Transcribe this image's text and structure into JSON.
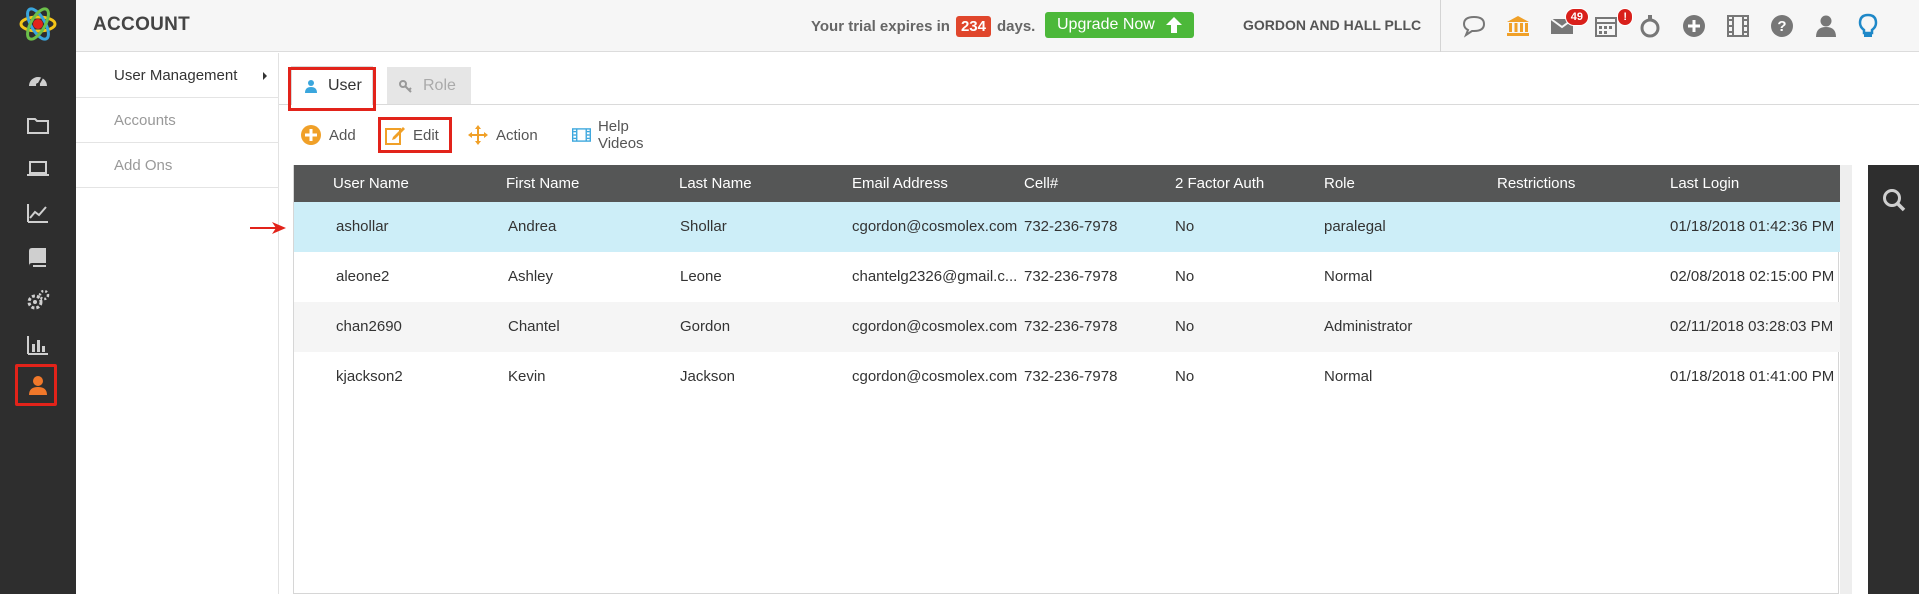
{
  "app": {
    "title": "ACCOUNT"
  },
  "header": {
    "trial_prefix": "Your trial expires in",
    "trial_days": "234",
    "trial_suffix": "days.",
    "upgrade_label": "Upgrade Now",
    "firm_name": "GORDON AND HALL PLLC",
    "icons": [
      {
        "name": "chat-icon"
      },
      {
        "name": "bank-icon"
      },
      {
        "name": "mail-icon",
        "badge": "49"
      },
      {
        "name": "calendar-icon",
        "badge": "!"
      },
      {
        "name": "timer-icon"
      },
      {
        "name": "add-circle-icon"
      },
      {
        "name": "film-icon"
      },
      {
        "name": "help-icon"
      },
      {
        "name": "user-profile-icon"
      },
      {
        "name": "lightbulb-icon"
      }
    ]
  },
  "rail": {
    "items": [
      "dashboard-icon",
      "folder-icon",
      "laptop-icon",
      "chart-line-icon",
      "book-icon",
      "gears-icon",
      "bar-chart-icon",
      "account-user-icon"
    ],
    "active": "account-user-icon"
  },
  "subnav": {
    "items": [
      {
        "label": "User Management",
        "selected": true
      },
      {
        "label": "Accounts",
        "selected": false
      },
      {
        "label": "Add Ons",
        "selected": false
      }
    ]
  },
  "tabs": [
    {
      "label": "User",
      "active": true
    },
    {
      "label": "Role",
      "active": false
    }
  ],
  "toolbar": {
    "add": "Add",
    "edit": "Edit",
    "action": "Action",
    "help_videos": "Help Videos"
  },
  "grid": {
    "columns": [
      "User Name",
      "First Name",
      "Last Name",
      "Email Address",
      "Cell#",
      "2 Factor Auth",
      "Role",
      "Restrictions",
      "Last Login"
    ],
    "rows": [
      [
        "ashollar",
        "Andrea",
        "Shollar",
        "cgordon@cosmolex.com",
        "732-236-7978",
        "No",
        "paralegal",
        "",
        "01/18/2018 01:42:36 PM"
      ],
      [
        "aleone2",
        "Ashley",
        "Leone",
        "chantelg2326@gmail.c...",
        "732-236-7978",
        "No",
        "Normal",
        "",
        "02/08/2018 02:15:00 PM"
      ],
      [
        "chan2690",
        "Chantel",
        "Gordon",
        "cgordon@cosmolex.com",
        "732-236-7978",
        "No",
        "Administrator",
        "",
        "02/11/2018 03:28:03 PM"
      ],
      [
        "kjackson2",
        "Kevin",
        "Jackson",
        "cgordon@cosmolex.com",
        "732-236-7978",
        "No",
        "Normal",
        "",
        "01/18/2018 01:41:00 PM"
      ]
    ],
    "selected_row": 0
  },
  "colors": {
    "accent_orange": "#f0a028",
    "highlight_red": "#e2231a",
    "selected_row": "#cdeef8",
    "header_dark": "#555656",
    "rail": "#2e2e2e",
    "upgrade_green": "#4cb83a"
  }
}
